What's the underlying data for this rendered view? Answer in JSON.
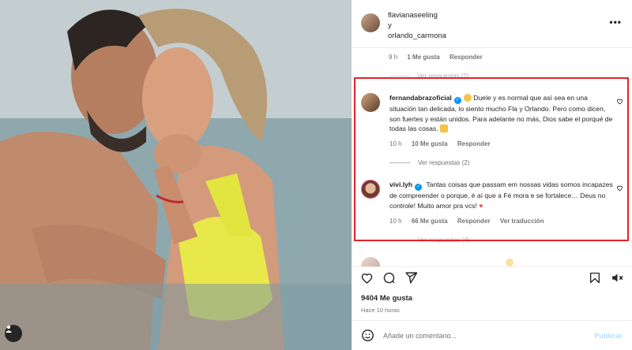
{
  "post": {
    "author": "flavianaseeling",
    "connector": "y",
    "coauthor": "orlando_carmona",
    "likes": "9404 Me gusta",
    "posted": "Hace 10 horas",
    "add_comment_placeholder": "Añade un comentario...",
    "publish_label": "Publicar"
  },
  "top_comment_meta": {
    "time": "9 h",
    "likes": "1 Me gusta",
    "reply": "Responder",
    "view_replies": "Ver respuestas (2)"
  },
  "comments": [
    {
      "user": "fernandabrazoficial",
      "text": "Duele y es normal que así sea en una situación tan delicada, lo siento mucho Fla y Orlando. Pero como dicen, son fuertes y están unidos. Para adelante no más, Dios sabe el porqué de todas las cosas.",
      "time": "10 h",
      "likes": "10 Me gusta",
      "reply": "Responder",
      "view_replies": "Ver respuestas (2)"
    },
    {
      "user": "vivi.lyh",
      "text": "Tantas coisas que passam em nossas vidas somos incapazes de compreender o porque, é aí que a Fé mora e se fortalece… Deus no controle! Muito amor pra vcs!",
      "time": "10 h",
      "likes": "66 Me gusta",
      "reply": "Responder",
      "translate": "Ver traducción",
      "view_replies": "Ver respuestas (4)"
    }
  ],
  "colors": {
    "highlight_box": "#e3222a",
    "verified": "#0095f6",
    "heart": "#ed4956"
  }
}
